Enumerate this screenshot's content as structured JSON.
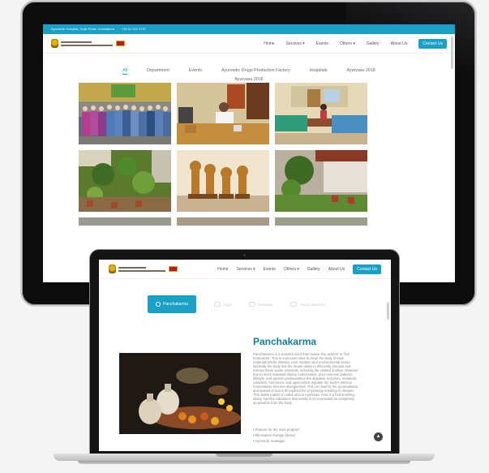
{
  "top_bar": {
    "address": "Ayurvedic Hospital, Galle Road, Unawatuna",
    "phone": "+94 91 222 4757"
  },
  "nav": {
    "items": [
      "Home",
      "Services ▾",
      "Events",
      "Others ▾",
      "Gallery",
      "About Us"
    ],
    "contact_label": "Contact Us"
  },
  "gallery_filters": {
    "row1": [
      "All",
      "Department",
      "Events",
      "Ayurvedic Drugs Production Factory",
      "Hospitals",
      "Ayurvasu 2018"
    ],
    "row2": [
      "Ayurvasu 2016"
    ],
    "active": "All"
  },
  "laptop": {
    "nav_items": [
      "Home",
      "Services ▾",
      "Events",
      "Others ▾",
      "Gallery",
      "About Us"
    ],
    "contact_label": "Contact Us",
    "tabs": [
      "Panchakarma",
      "Yoga",
      "Massage",
      "Herbal Medicine"
    ],
    "active_tab": "Panchakarma",
    "title": "Panchakarma",
    "paragraph": "Panchakarma is a Sanskrit word that means 'five actions' or 'five treatments'. This is a process used to clean the body of toxic materials left by disease, poor nutrition and environmental toxins. Normally the body has the innate ability to efficiently process and remove these waste materials, including the vitiated doshas. However due to one's repeated dietary indiscretions, poor exercise patterns, lifestyle, and genetic predisposition the digestive enzymes, metabolic cofactors, hormones, and agnis which regulate the body's internal homeostasis become disorganized. This can lead to the accumulation and spread of toxins throughout the physiology resulting in disease. This waste matter is called ama in Ayurveda. Ama is a foul-smelling, sticky, harmful substance that needs to be evacuated as completely as possible from the body.",
    "bullets": [
      "Prepare for the main program",
      "Elimination therapy (detox)",
      "Ayurvedic massage"
    ]
  }
}
